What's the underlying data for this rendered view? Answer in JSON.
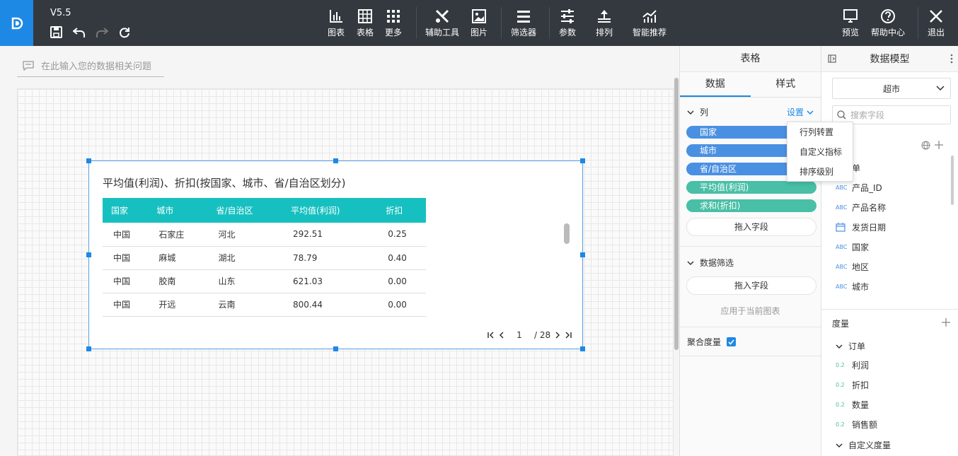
{
  "app": {
    "version": "V5.5"
  },
  "toolbar": {
    "chart": "图表",
    "table": "表格",
    "more": "更多",
    "tools": "辅助工具",
    "image": "图片",
    "filter": "筛选器",
    "params": "参数",
    "arrange": "排列",
    "smart": "智能推荐",
    "preview": "预览",
    "help": "帮助中心",
    "exit": "退出"
  },
  "question": {
    "placeholder": "在此输入您的数据相关问题"
  },
  "widget": {
    "title": "平均值(利润)、折扣(按国家、城市、省/自治区划分)",
    "columns": [
      "国家",
      "城市",
      "省/自治区",
      "平均值(利润)",
      "折扣"
    ],
    "rows": [
      [
        "中国",
        "石家庄",
        "河北",
        "292.51",
        "0.25"
      ],
      [
        "中国",
        "麻城",
        "湖北",
        "78.79",
        "0.40"
      ],
      [
        "中国",
        "胶南",
        "山东",
        "621.03",
        "0.00"
      ],
      [
        "中国",
        "开远",
        "云南",
        "800.44",
        "0.00"
      ]
    ],
    "pager": {
      "current": "1",
      "total": "/ 28"
    }
  },
  "config": {
    "title": "表格",
    "tabs": [
      "数据",
      "样式"
    ],
    "columns_section": "列",
    "settings": "设置",
    "pills": [
      "国家",
      "城市",
      "省/自治区",
      "平均值(利润)",
      "求和(折扣)"
    ],
    "drop": "拖入字段",
    "filter_section": "数据筛选",
    "apply": "应用于当前图表",
    "aggregate": "聚合度量"
  },
  "popup": {
    "items": [
      "行列转置",
      "自定义指标",
      "排序级别"
    ]
  },
  "model": {
    "title": "数据模型",
    "dataset": "超市",
    "search_placeholder": "搜索字段",
    "dimensions": [
      {
        "tag": "",
        "name": "单"
      },
      {
        "tag": "ABC",
        "name": "产品_ID"
      },
      {
        "tag": "ABC",
        "name": "产品名称"
      },
      {
        "tag": "date",
        "name": "发货日期"
      },
      {
        "tag": "ABC",
        "name": "国家"
      },
      {
        "tag": "ABC",
        "name": "地区"
      },
      {
        "tag": "ABC",
        "name": "城市"
      }
    ],
    "measures_title": "度量",
    "measure_group": "订单",
    "measures": [
      "利润",
      "折扣",
      "数量",
      "销售额"
    ],
    "measure_tag": "0.2",
    "custom_group": "自定义度量"
  },
  "colors": {
    "toolbar": "#33393f",
    "accent": "#1e88e5",
    "header": "#17c0c0",
    "measure_pill": "#48bfa6",
    "dim_pill": "#4a90e2"
  }
}
